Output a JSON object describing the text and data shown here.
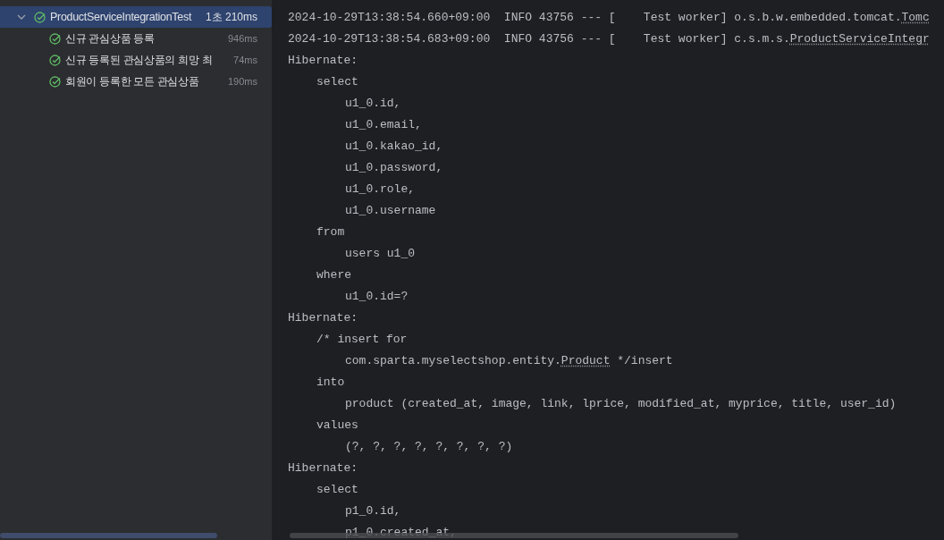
{
  "test_tree": {
    "name": "ProductServiceIntegrationTest",
    "time": "1초 210ms",
    "passed": true,
    "expanded": true,
    "selected": true,
    "children": [
      {
        "name": "신규 관심상품 등록",
        "time": "946ms",
        "passed": true,
        "selected": false
      },
      {
        "name": "신규 등록된 관심상품의 희망 최",
        "time": "74ms",
        "passed": true,
        "selected": false
      },
      {
        "name": "회원이 등록한 모든 관심상품",
        "time": "190ms",
        "passed": true,
        "selected": false
      }
    ]
  },
  "console": {
    "lines": [
      {
        "kind": "top",
        "parts": [
          {
            "text": "2024-10-29T13:38:54.660+09:00  INFO 43756 --- [    Test worker] o.s.b.w.embedded.tomcat.",
            "underlined": false
          },
          {
            "text": "Tomc",
            "underlined": true
          }
        ]
      },
      {
        "kind": "top",
        "parts": [
          {
            "text": "2024-10-29T13:38:54.683+09:00  INFO 43756 --- [    Test worker] c.s.m.s.",
            "underlined": false
          },
          {
            "text": "ProductServiceIntegr",
            "underlined": true
          }
        ]
      },
      {
        "kind": "top",
        "parts": [
          {
            "text": "Hibernate:",
            "underlined": false
          }
        ]
      },
      {
        "kind": "clause",
        "parts": [
          {
            "text": "select",
            "underlined": false
          }
        ]
      },
      {
        "kind": "item",
        "parts": [
          {
            "text": "u1_0.id,",
            "underlined": false
          }
        ]
      },
      {
        "kind": "item",
        "parts": [
          {
            "text": "u1_0.email,",
            "underlined": false
          }
        ]
      },
      {
        "kind": "item",
        "parts": [
          {
            "text": "u1_0.kakao_id,",
            "underlined": false
          }
        ]
      },
      {
        "kind": "item",
        "parts": [
          {
            "text": "u1_0.password,",
            "underlined": false
          }
        ]
      },
      {
        "kind": "item",
        "parts": [
          {
            "text": "u1_0.role,",
            "underlined": false
          }
        ]
      },
      {
        "kind": "item",
        "parts": [
          {
            "text": "u1_0.username",
            "underlined": false
          }
        ]
      },
      {
        "kind": "clause",
        "parts": [
          {
            "text": "from",
            "underlined": false
          }
        ]
      },
      {
        "kind": "item",
        "parts": [
          {
            "text": "users u1_0",
            "underlined": false
          }
        ]
      },
      {
        "kind": "clause",
        "parts": [
          {
            "text": "where",
            "underlined": false
          }
        ]
      },
      {
        "kind": "item",
        "parts": [
          {
            "text": "u1_0.id=?",
            "underlined": false
          }
        ]
      },
      {
        "kind": "top",
        "parts": [
          {
            "text": "Hibernate:",
            "underlined": false
          }
        ]
      },
      {
        "kind": "clause",
        "parts": [
          {
            "text": "/* insert for",
            "underlined": false
          }
        ]
      },
      {
        "kind": "item",
        "parts": [
          {
            "text": "com.sparta.myselectshop.entity.",
            "underlined": false
          },
          {
            "text": "Product",
            "underlined": true
          },
          {
            "text": " */insert",
            "underlined": false
          }
        ]
      },
      {
        "kind": "clause",
        "parts": [
          {
            "text": "into",
            "underlined": false
          }
        ]
      },
      {
        "kind": "item",
        "parts": [
          {
            "text": "product (created_at, image, link, lprice, modified_at, myprice, title, user_id)",
            "underlined": false
          }
        ]
      },
      {
        "kind": "clause",
        "parts": [
          {
            "text": "values",
            "underlined": false
          }
        ]
      },
      {
        "kind": "item",
        "parts": [
          {
            "text": "(?, ?, ?, ?, ?, ?, ?, ?)",
            "underlined": false
          }
        ]
      },
      {
        "kind": "top",
        "parts": [
          {
            "text": "Hibernate:",
            "underlined": false
          }
        ]
      },
      {
        "kind": "clause",
        "parts": [
          {
            "text": "select",
            "underlined": false
          }
        ]
      },
      {
        "kind": "item",
        "parts": [
          {
            "text": "p1_0.id,",
            "underlined": false
          }
        ]
      },
      {
        "kind": "item",
        "parts": [
          {
            "text": "p1_0.created_at,",
            "underlined": false
          }
        ]
      }
    ]
  }
}
